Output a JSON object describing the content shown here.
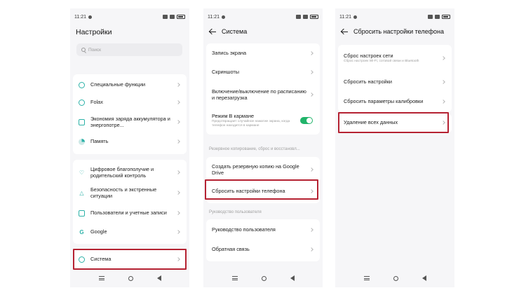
{
  "status": {
    "time": "11:21"
  },
  "screen1": {
    "title": "Настройки",
    "search_placeholder": "Поиск",
    "items": [
      {
        "label": "Специальные функции",
        "icon": "accessibility-icon"
      },
      {
        "label": "Folax",
        "icon": "folax-icon"
      },
      {
        "label": "Экономия заряда аккумулятора и энергопотре...",
        "icon": "battery-saver-icon"
      },
      {
        "label": "Память",
        "icon": "storage-icon"
      },
      {
        "label": "Цифровое благополучие и родительский контроль",
        "icon": "wellbeing-heart-icon"
      },
      {
        "label": "Безопасность и экстренные ситуации",
        "icon": "warning-triangle-icon"
      },
      {
        "label": "Пользователи и учетные записи",
        "icon": "user-icon"
      },
      {
        "label": "Google",
        "icon": "google-icon"
      },
      {
        "label": "Система",
        "icon": "system-gear-icon"
      }
    ]
  },
  "screen2": {
    "title": "Система",
    "items": [
      {
        "label": "Запись экрана"
      },
      {
        "label": "Скриншоты"
      },
      {
        "label": "Включение/выключение по расписанию и перезагрузка"
      },
      {
        "label": "Режим В кармане",
        "sub": "Предотвращает случайное нажатие экрана, когда телефон находится в кармане",
        "toggle": true
      },
      {
        "label": "Создать резервную копию на Google Drive"
      },
      {
        "label": "Сбросить настройки телефона"
      },
      {
        "label": "Руководство пользователя"
      },
      {
        "label": "Обратная связь"
      }
    ],
    "section_backup": "Резервное копирование, сброс и восстановл...",
    "section_guide": "Руководство пользователя"
  },
  "screen3": {
    "title": "Сбросить настройки телефона",
    "items": [
      {
        "label": "Сброс настроек сети",
        "sub": "Сброс настроек Wi-Fi, сотовой связи и Bluetooth"
      },
      {
        "label": "Сбросить настройки"
      },
      {
        "label": "Сбросить параметры калибровки"
      },
      {
        "label": "Удаление всех данных"
      }
    ]
  },
  "colors": {
    "accent": "#2db2a8",
    "highlight": "#b52232",
    "toggle_on": "#21b46a"
  }
}
